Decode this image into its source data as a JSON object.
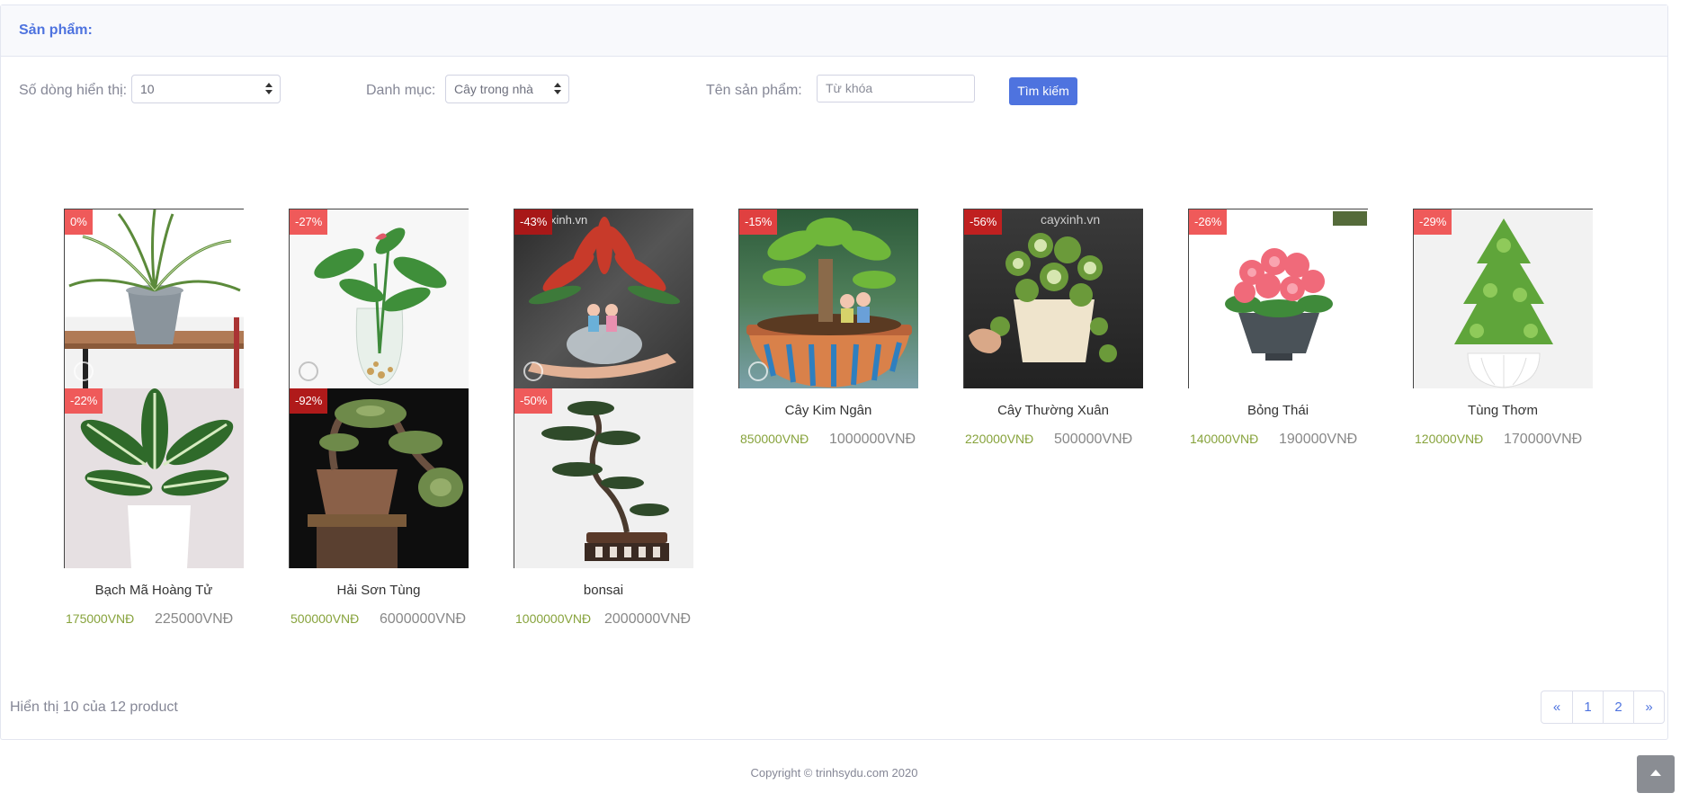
{
  "header": {
    "title": "Sản phẩm:"
  },
  "filters": {
    "rows_label": "Số dòng hiển thị:",
    "rows_value": "10",
    "category_label": "Danh mục:",
    "category_value": "Cây trong nhà",
    "name_label": "Tên sản phẩm:",
    "search_placeholder": "Từ khóa",
    "search_button": "Tìm kiếm"
  },
  "products": [
    {
      "name": "Cây Kim Ngân",
      "discount": "-15%",
      "price_new": "850000VNĐ",
      "price_old": "1000000VNĐ"
    },
    {
      "name": "Cây Thường Xuân",
      "discount": "-56%",
      "price_new": "220000VNĐ",
      "price_old": "500000VNĐ"
    },
    {
      "name": "Bỏng Thái",
      "discount": "-26%",
      "price_new": "140000VNĐ",
      "price_old": "190000VNĐ"
    },
    {
      "name": "Tùng Thơm",
      "discount": "-29%",
      "price_new": "120000VNĐ",
      "price_old": "170000VNĐ"
    },
    {
      "name": "",
      "discount": "0%",
      "price_new": "",
      "price_old": ""
    },
    {
      "name": "",
      "discount": "-27%",
      "price_new": "",
      "price_old": ""
    },
    {
      "name": "",
      "discount": "-43%",
      "price_new": "",
      "price_old": ""
    },
    {
      "name": "Bạch Mã Hoàng Tử",
      "discount": "-22%",
      "price_new": "175000VNĐ",
      "price_old": "225000VNĐ"
    },
    {
      "name": "Hải Sơn Tùng",
      "discount": "-92%",
      "price_new": "500000VNĐ",
      "price_old": "6000000VNĐ"
    },
    {
      "name": "bonsai",
      "discount": "-50%",
      "price_new": "1000000VNĐ",
      "price_old": "2000000VNĐ"
    }
  ],
  "watermarks": {
    "p3": "xinh.vn",
    "p5": "cayxinh.vn"
  },
  "footer": {
    "info": "Hiển thị 10 của 12 product",
    "pages": [
      "«",
      "1",
      "2",
      "»"
    ],
    "copyright": "Copyright © trinhsydu.com 2020"
  }
}
